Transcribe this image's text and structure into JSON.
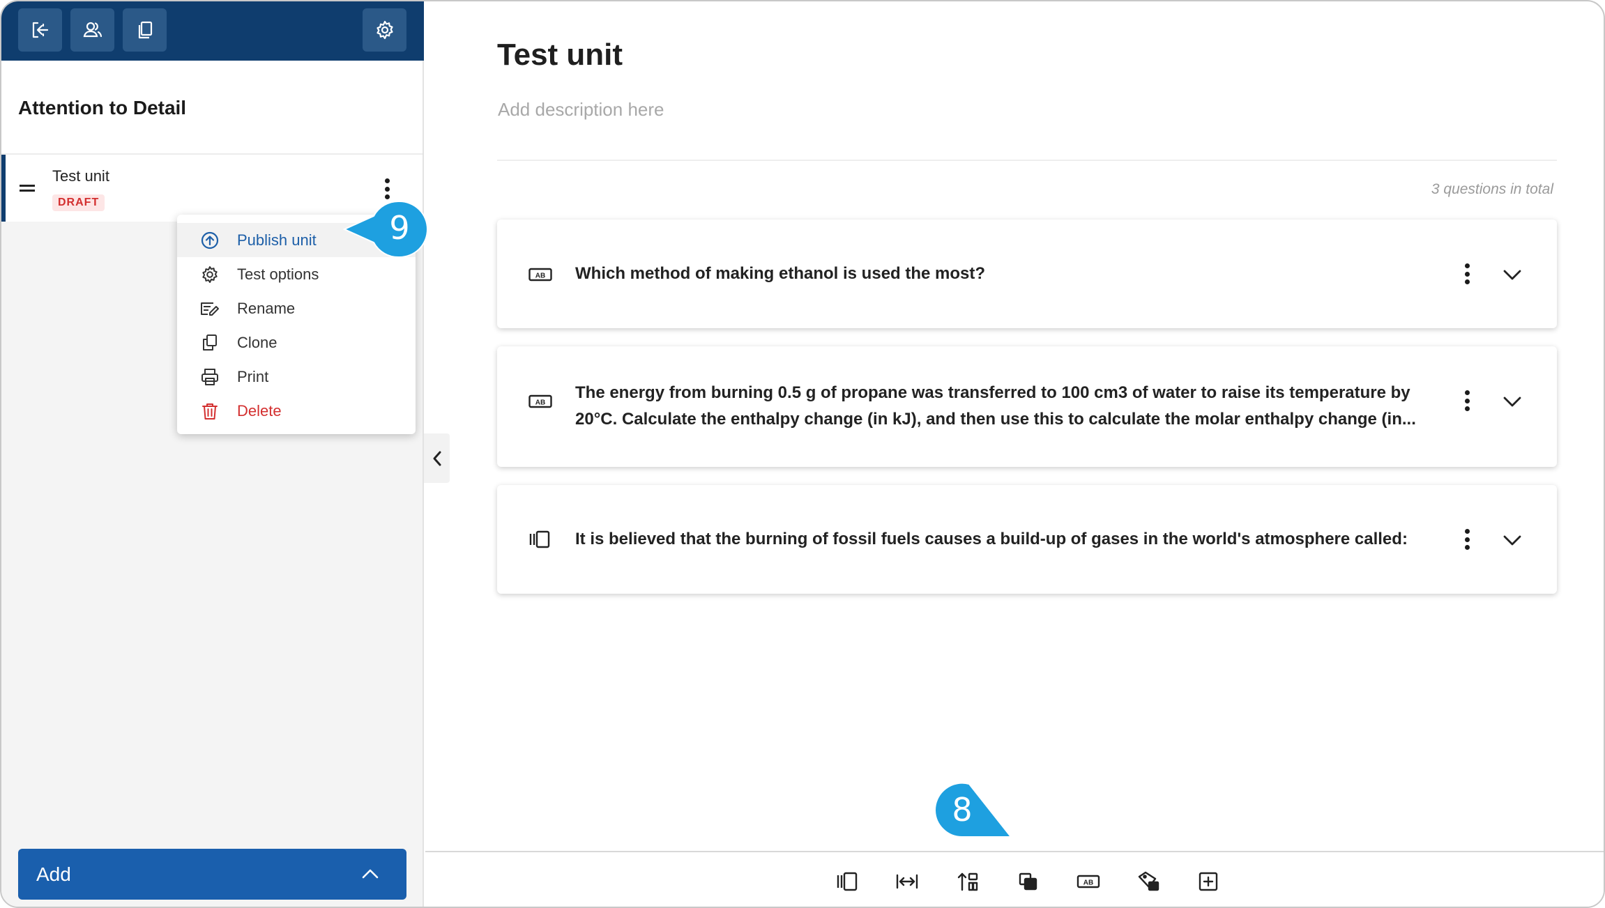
{
  "sidebar": {
    "title": "Attention to Detail",
    "unit": {
      "name": "Test unit",
      "status": "DRAFT"
    },
    "context_menu": [
      {
        "label": "Publish unit",
        "icon": "upload-circle-icon"
      },
      {
        "label": "Test options",
        "icon": "gear-icon"
      },
      {
        "label": "Rename",
        "icon": "rename-icon"
      },
      {
        "label": "Clone",
        "icon": "copy-icon"
      },
      {
        "label": "Print",
        "icon": "printer-icon"
      },
      {
        "label": "Delete",
        "icon": "trash-icon"
      }
    ],
    "add_label": "Add"
  },
  "main": {
    "title": "Test unit",
    "description_placeholder": "Add description here",
    "question_count": "3 questions in total",
    "questions": [
      {
        "text": "Which method of making ethanol is used the most?",
        "icon": "text-answer-icon"
      },
      {
        "text_line1": "The energy from burning 0.5 g of propane was transferred to 100 cm3 of water to raise its temperature by",
        "text_line2": "20°C. Calculate the enthalpy change (in kJ), and then use this to calculate the molar enthalpy change (in...",
        "icon": "text-answer-icon"
      },
      {
        "text": "It is believed that the burning of fossil fuels causes a build-up of gases in the world's atmosphere called:",
        "icon": "multiple-choice-icon"
      }
    ]
  },
  "callouts": {
    "publish": "9",
    "toolbar": "8"
  },
  "colors": {
    "brand_dark": "#0f3d6e",
    "accent": "#1a5fad",
    "callout": "#1ea0e0",
    "danger": "#d32f2f"
  }
}
